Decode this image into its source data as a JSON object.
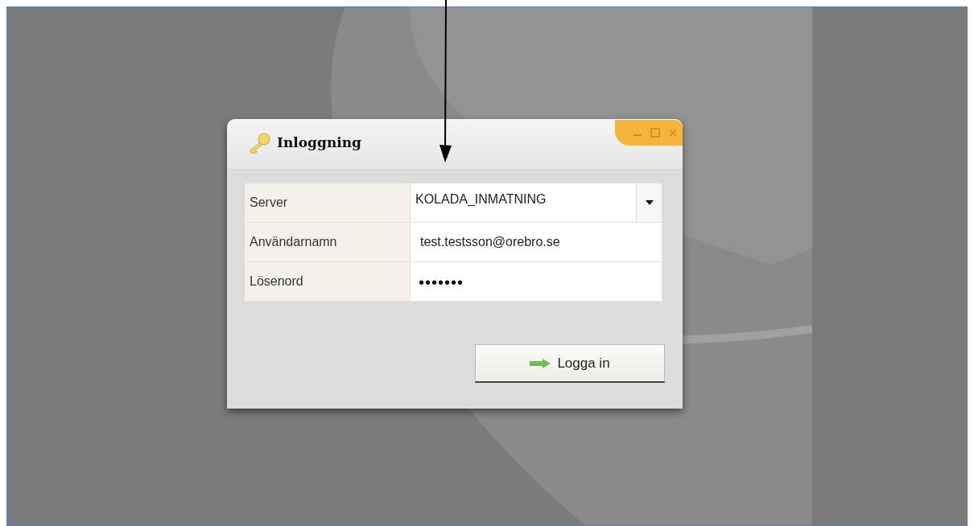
{
  "window": {
    "title": "Inloggning"
  },
  "fields": [
    {
      "kind": "select",
      "label": "Server",
      "value": "KOLADA_INMATNING"
    },
    {
      "kind": "text",
      "label": "Användarnamn",
      "value": "test.testsson@orebro.se"
    },
    {
      "kind": "password",
      "label": "Lösenord",
      "value": "•••••••"
    }
  ],
  "login_button": {
    "label": "Logga in"
  }
}
